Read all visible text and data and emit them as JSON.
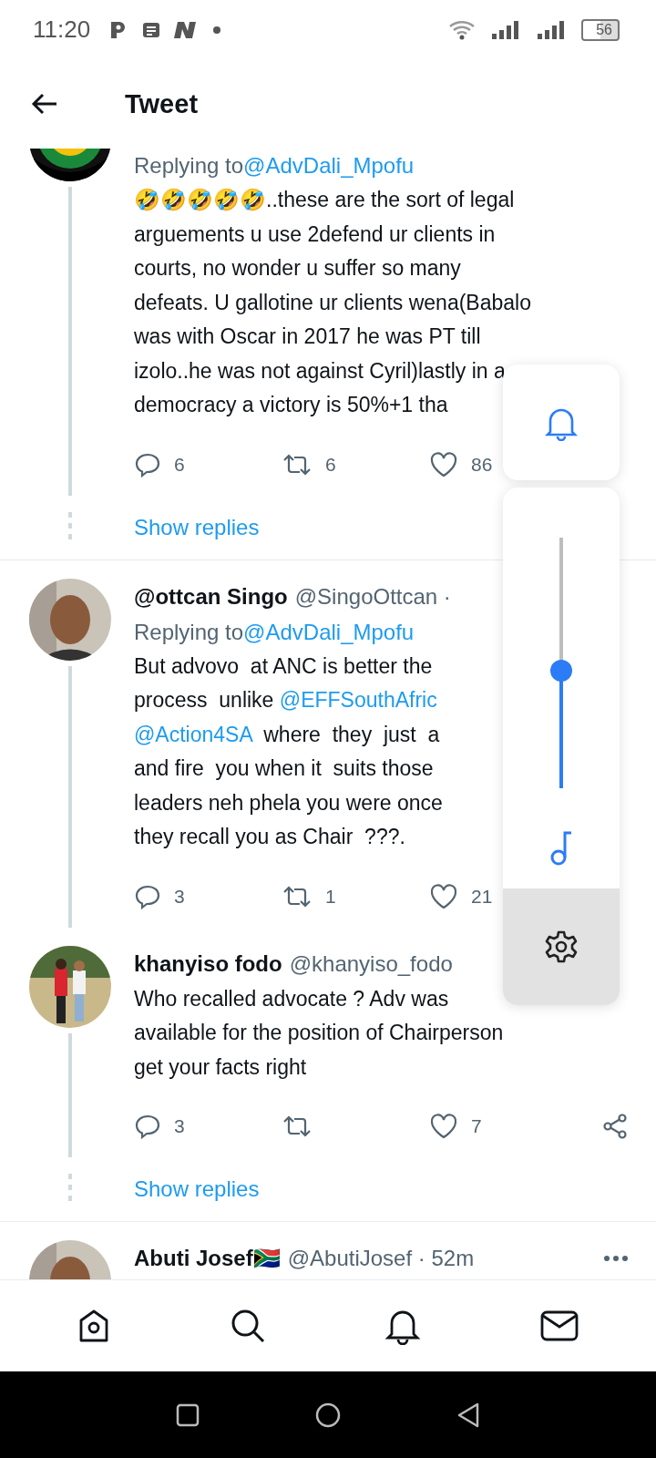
{
  "status_bar": {
    "time": "11:20",
    "battery": "56"
  },
  "header": {
    "title": "Tweet"
  },
  "tweets": [
    {
      "replying_label": "Replying to",
      "replying_mention": "@AdvDali_Mpofu",
      "lines": [
        [
          {
            "text": "🤣🤣🤣🤣🤣..these are the sort of legal",
            "link": false
          }
        ],
        [
          {
            "text": "arguements u use 2defend ur clients in",
            "link": false
          }
        ],
        [
          {
            "text": "courts, no wonder u suffer so many",
            "link": false
          }
        ],
        [
          {
            "text": "defeats. U gallotine ur clients wena(Babalo",
            "link": false
          }
        ],
        [
          {
            "text": "was with Oscar in 2017 he was PT till",
            "link": false
          }
        ],
        [
          {
            "text": "izolo..he was not against Cyril)lastly in a",
            "link": false
          }
        ],
        [
          {
            "text": "democracy a victory is 50%+1 tha",
            "link": false
          }
        ]
      ],
      "replies": "6",
      "retweets": "6",
      "likes": "86",
      "show_replies": "Show replies"
    },
    {
      "name": "@ottcan Singo",
      "handle": "@SingoOttcan ·",
      "replying_label": "Replying to",
      "replying_mention": "@AdvDali_Mpofu",
      "lines": [
        [
          {
            "text": "But advovo  at ANC is better the",
            "link": false
          }
        ],
        [
          {
            "text": "process  unlike ",
            "link": false
          },
          {
            "text": "@EFFSouthAfric",
            "link": true
          }
        ],
        [
          {
            "text": "@Action4SA",
            "link": true
          },
          {
            "text": "  where  they  just  a",
            "link": false
          }
        ],
        [
          {
            "text": "and fire  you when it  suits those",
            "link": false
          }
        ],
        [
          {
            "text": "leaders neh phela you were once",
            "link": false
          }
        ],
        [
          {
            "text": "they recall you as Chair  ???.",
            "link": false
          }
        ]
      ],
      "replies": "3",
      "retweets": "1",
      "likes": "21"
    },
    {
      "name": "khanyiso fodo",
      "handle": "@khanyiso_fodo",
      "lines": [
        [
          {
            "text": "Who recalled advocate ? Adv was",
            "link": false
          }
        ],
        [
          {
            "text": "available for the position of Chairperson",
            "link": false
          }
        ],
        [
          {
            "text": "get your facts right",
            "link": false
          }
        ]
      ],
      "replies": "3",
      "likes": "7",
      "show_replies": "Show replies"
    },
    {
      "name": "Abuti Josef🇿🇦",
      "handle": "@AbutiJosef · 52m"
    }
  ],
  "volume_panel": {
    "level": 0.47
  },
  "bottom_nav": [
    {
      "kind": "home"
    },
    {
      "kind": "search"
    },
    {
      "kind": "bell"
    },
    {
      "kind": "mail"
    }
  ],
  "system_nav": [
    {
      "kind": "square"
    },
    {
      "kind": "circle"
    },
    {
      "kind": "back"
    }
  ]
}
